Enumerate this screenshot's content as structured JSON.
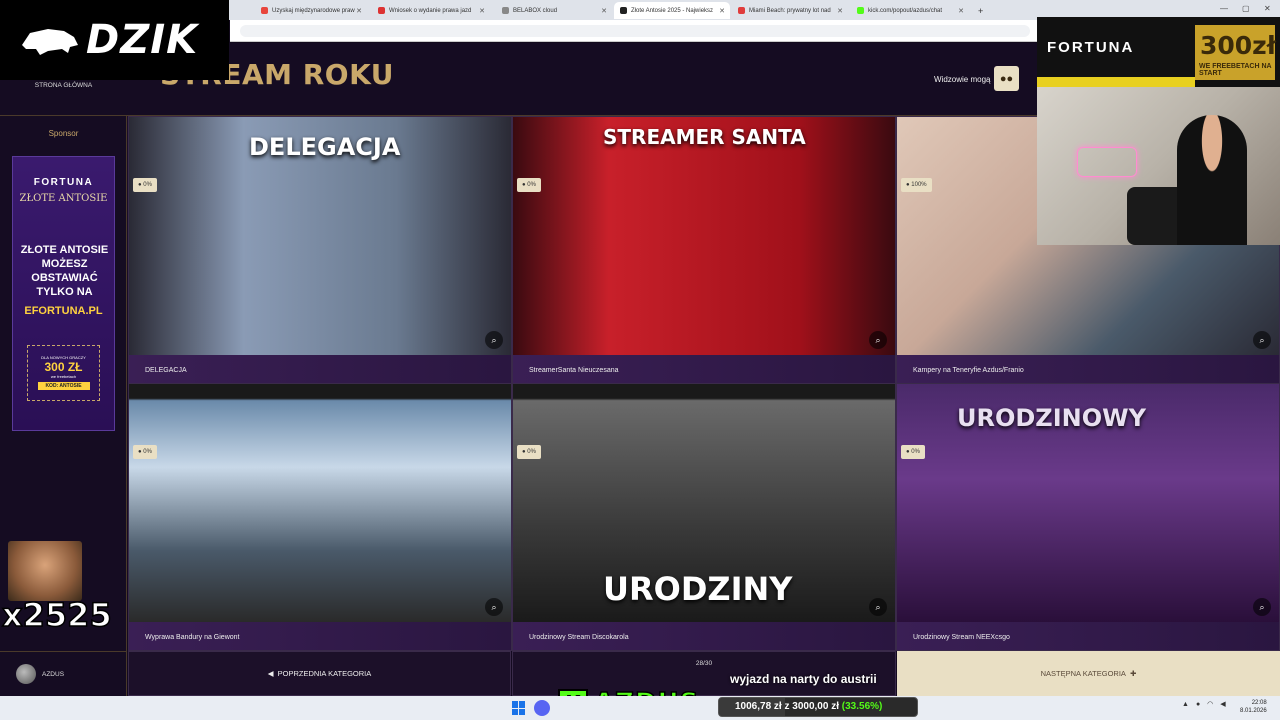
{
  "browser": {
    "tabs": [
      {
        "label": "Uzyskaj międzynarodowe praw",
        "favicon_color": "#e8453c",
        "active": false
      },
      {
        "label": "Wniosek o wydanie prawa jazd",
        "favicon_color": "#d33",
        "active": false
      },
      {
        "label": "BELABOX cloud",
        "favicon_color": "#888",
        "active": false
      },
      {
        "label": "Złote Antosie 2025 - Najwieksz",
        "favicon_color": "#222",
        "active": true
      },
      {
        "label": "Miami Beach: prywatny lot nad",
        "favicon_color": "#e03c3c",
        "active": false
      },
      {
        "label": "kick.com/popout/azdus/chat",
        "favicon_color": "#53fc18",
        "active": false
      }
    ],
    "new_tab": "+",
    "window_controls": [
      "—",
      "▢",
      "✕"
    ]
  },
  "brand_overlay": {
    "text": "DZIK"
  },
  "header": {
    "home_link": "STRONA GŁÓWNA",
    "title": "STREAM ROKU",
    "viewers_label": "Widzowie mogą",
    "viewers_icon": "users-icon"
  },
  "sidebar": {
    "sponsor_label": "Sponsor",
    "ad": {
      "brand": "FORTUNA",
      "event": "ZŁOTE ANTOSIE",
      "headline": "ZŁOTE ANTOSIE MOŻESZ OBSTAWIAĆ TYLKO NA",
      "site": "EFORTUNA.PL",
      "promo_top": "DLA NOWYCH GRACZY",
      "promo_amount": "300 ZŁ",
      "promo_sub": "we freebetach",
      "promo_code": "KOD: ANTOSIE"
    },
    "user": {
      "name": "AZDUS"
    }
  },
  "emote_overlay": {
    "count": "x2525"
  },
  "cards": [
    {
      "caption": "DELEGACJA",
      "percent": "0%",
      "poster_text": "DELEGACJA",
      "color_a": "#8a9bb5",
      "color_b": "#3a3a4a"
    },
    {
      "caption": "StreamerSanta Nieuczesana",
      "percent": "0%",
      "poster_text": "STREAMER SANTA",
      "color_a": "#c8202a",
      "color_b": "#6a0a12"
    },
    {
      "caption": "Kampery na Teneryfie Azdus/Franio",
      "percent": "100%",
      "poster_text": "",
      "color_a": "#d8c0b0",
      "color_b": "#3a2a2a"
    },
    {
      "caption": "Wyprawa Bandury na Giewont",
      "percent": "0%",
      "poster_text": "",
      "color_a": "#4a6a8a",
      "color_b": "#1a2a3a"
    },
    {
      "caption": "Urodzinowy Stream Discokarola",
      "percent": "0%",
      "poster_text": "URODZINY",
      "color_a": "#5a5a5a",
      "color_b": "#1a1a1a"
    },
    {
      "caption": "Urodzinowy Stream NEEXcsgo",
      "percent": "0%",
      "poster_text": "URODZINOWY",
      "color_a": "#6a3a8a",
      "color_b": "#2a0f3a"
    }
  ],
  "bottom_nav": {
    "prev": "POPRZEDNIA KATEGORIA",
    "page": "28/30",
    "next": "NASTĘPNA KATEGORIA"
  },
  "stream": {
    "sponsor_brand": "FORTUNA",
    "sponsor_amount": "300zł",
    "sponsor_sub": "WE FREEBETACH NA START",
    "donation_message": "wyjazd na narty do austrii",
    "kick_logo": "K",
    "streamer": "AZDUS",
    "goal_current": "1006,78 zł",
    "goal_sep": "z",
    "goal_target": "3000,00 zł",
    "goal_percent": "(33.56%)",
    "goal_fraction": 0.3356
  },
  "taskbar": {
    "time": "22:08",
    "date": "8.01.2026"
  }
}
